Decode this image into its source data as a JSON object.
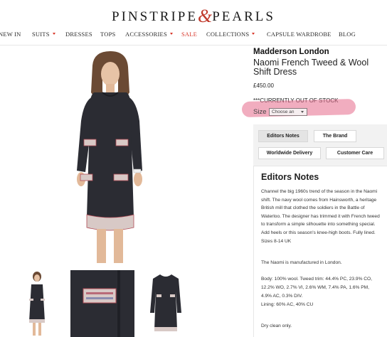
{
  "header": {
    "logo_part1": "PINSTRIPE",
    "logo_amp": "&",
    "logo_part2": "PEARLS",
    "accent_color": "#d8362a"
  },
  "nav": {
    "items": [
      {
        "label": "NEW IN",
        "has_dropdown": false
      },
      {
        "label": "SUITS",
        "has_dropdown": true
      },
      {
        "label": "DRESSES",
        "has_dropdown": false
      },
      {
        "label": "TOPS",
        "has_dropdown": false
      },
      {
        "label": "ACCESSORIES",
        "has_dropdown": true
      },
      {
        "label": "SALE",
        "has_dropdown": false
      },
      {
        "label": "COLLECTIONS",
        "has_dropdown": true
      },
      {
        "label": "CAPSULE WARDROBE",
        "has_dropdown": false
      },
      {
        "label": "BLOG",
        "has_dropdown": false
      }
    ]
  },
  "product": {
    "brand": "Madderson London",
    "name": "Naomi French Tweed & Wool Shift Dress",
    "price": "£450.00",
    "stock_status": "***CURRENTLY OUT OF STOCK",
    "size_label": "Size",
    "size_placeholder": "Choose an"
  },
  "tabs": {
    "editors_notes": "Editors Notes",
    "the_brand": "The Brand",
    "worldwide_delivery": "Worldwide Delivery",
    "customer_care": "Customer Care"
  },
  "editors_notes": {
    "title": "Editors Notes",
    "description": "Channel the big 1960s trend of the season in the Naomi shift. The navy wool comes from Hainsworth, a heritage British mill that clothed the soldiers in the Battle of Waterloo. The designer has trimmed it with French tweed to transform a simple silhouette into something special. Add heels or this season's knee-high boots. Fully lined. Sizes 8-14 UK",
    "manufactured": "The Naomi is manufactured in London.",
    "composition_1": "Body: 100% wool. Tweed trim: 44.4% PC, 23.9% CO,",
    "composition_2": "12.2% WO, 2.7% VI, 2.6% WM, 7.4% PA, 1.6% PM,",
    "composition_3": "4.9% AC, 0.3% DIV.",
    "lining": "Lining: 60% AC, 40% CU",
    "care": "Dry clean only."
  }
}
